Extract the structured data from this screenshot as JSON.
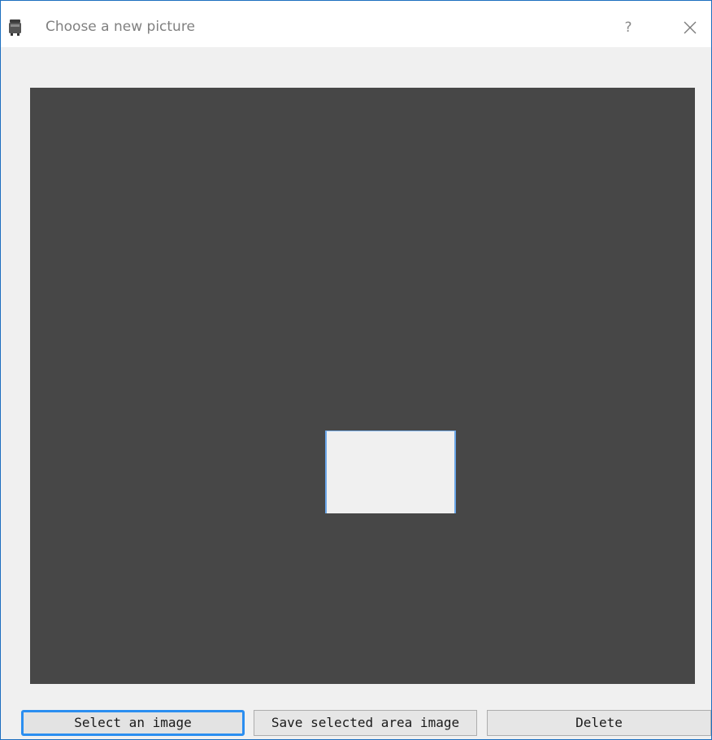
{
  "window": {
    "title": "Choose a new picture",
    "help_label": "?",
    "icons": {
      "app": "printer-icon",
      "close": "close-icon"
    }
  },
  "canvas": {
    "background_color": "#474747",
    "selection_border_color": "#6aa6e8"
  },
  "buttons": {
    "select_image": "Select an image",
    "save_selected": "Save selected area image",
    "delete": "Delete",
    "focused": "select_image",
    "focus_color": "#2b8ef0"
  }
}
